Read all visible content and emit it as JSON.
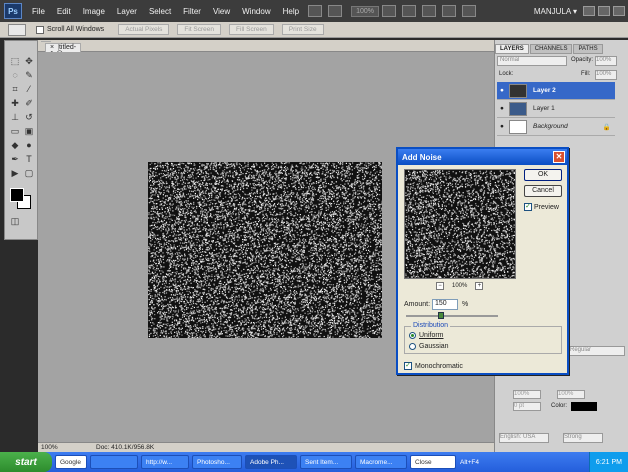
{
  "app": {
    "menus": [
      "File",
      "Edit",
      "Image",
      "Layer",
      "Select",
      "Filter",
      "View",
      "Window",
      "Help"
    ],
    "zoom_dropdown": "100%",
    "workspace_user": "MANJULA",
    "workspace_arrow": "▾"
  },
  "options_bar": {
    "scroll_all_windows": "Scroll All Windows",
    "buttons": [
      "Actual Pixels",
      "Fit Screen",
      "Fill Screen",
      "Print Size"
    ]
  },
  "document": {
    "tab_title": "Untitled-1 @ 100% (Layer 2, RGB/8) *",
    "tab_close": "×",
    "status_zoom": "100%",
    "status_doc": "Doc: 410.1K/956.8K"
  },
  "layers_panel": {
    "tabs": [
      "LAYERS",
      "CHANNELS",
      "PATHS"
    ],
    "blend_mode": "Normal",
    "opacity_label": "Opacity:",
    "opacity_value": "100%",
    "lock_label": "Lock:",
    "fill_label": "Fill:",
    "fill_value": "100%",
    "layers": [
      {
        "name": "Layer 2",
        "selected": true
      },
      {
        "name": "Layer 1",
        "selected": false
      },
      {
        "name": "Background",
        "selected": false
      }
    ]
  },
  "char_panel": {
    "font_family_text": "Regular",
    "font_size": "100%",
    "font_size2": "100%",
    "font_small": "0 pt",
    "color_label": "Color:",
    "leading": "(Auto)",
    "tracking": "0",
    "language": "English: USA",
    "aa": "Strong"
  },
  "add_noise": {
    "title": "Add Noise",
    "ok": "OK",
    "cancel": "Cancel",
    "preview_label": "Preview",
    "preview_checked": true,
    "zoom": "100%",
    "amount_label": "Amount:",
    "amount_value": "150",
    "amount_unit": "%",
    "distribution_label": "Distribution",
    "uniform": "Uniform",
    "gaussian": "Gaussian",
    "selected_distribution": "Uniform",
    "monochromatic": "Monochromatic",
    "monochromatic_checked": true
  },
  "taskbar": {
    "start": "start",
    "google": "Google",
    "items": [
      "http://w...",
      "Photosho...",
      "Adobe Ph...",
      "Sent Item...",
      "Macrome...",
      "Close"
    ],
    "alt_hint": "Alt+F4",
    "clock": "6:21 PM"
  }
}
